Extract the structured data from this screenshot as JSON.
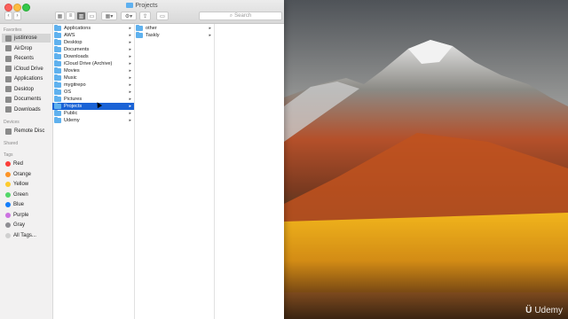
{
  "window": {
    "title": "Projects"
  },
  "toolbar": {
    "search_placeholder": "Search"
  },
  "sidebar": {
    "favorites_label": "Favorites",
    "favorites": [
      "justinrose",
      "AirDrop",
      "Recents",
      "iCloud Drive",
      "Applications",
      "Desktop",
      "Documents",
      "Downloads"
    ],
    "devices_label": "Devices",
    "devices": [
      "Remote Disc"
    ],
    "shared_label": "Shared",
    "tags_label": "Tags",
    "tags": [
      {
        "label": "Red",
        "color": "#fc3d39"
      },
      {
        "label": "Orange",
        "color": "#fd9426"
      },
      {
        "label": "Yellow",
        "color": "#fecb2e"
      },
      {
        "label": "Green",
        "color": "#53d769"
      },
      {
        "label": "Blue",
        "color": "#147efb"
      },
      {
        "label": "Purple",
        "color": "#cc73e1"
      },
      {
        "label": "Gray",
        "color": "#8e8e93"
      },
      {
        "label": "All Tags...",
        "color": "#d0d0d0"
      }
    ]
  },
  "column1": [
    "Applications",
    "AWS",
    "Desktop",
    "Documents",
    "Downloads",
    "iCloud Drive (Archive)",
    "Movies",
    "Music",
    "mygitrepo",
    "OS",
    "Pictures",
    "Projects",
    "Public",
    "Udemy"
  ],
  "column1_selected": "Projects",
  "column2": [
    "other",
    "Taskly"
  ],
  "watermark": {
    "brand": "Udemy"
  }
}
